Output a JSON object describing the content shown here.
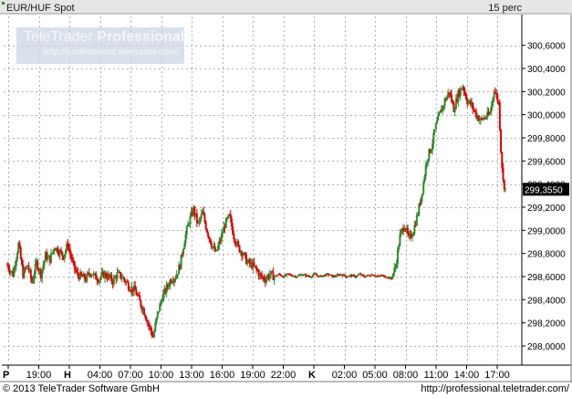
{
  "header": {
    "instrument": "EUR/HUF Spot",
    "interval": "15 perc"
  },
  "watermark": {
    "brand_regular": "TeleTrader",
    "brand_bold": "Professional",
    "url": "http://professional.teletrader.com/"
  },
  "footer": {
    "copyright": "© 2013 TeleTrader Software GmbH",
    "url": "http://professional.teletrader.com/"
  },
  "colors": {
    "up": "#2e8b2e",
    "down": "#e00000",
    "grid": "#b0b0b0",
    "header_bg": "#e6e6e6"
  },
  "chart_data": {
    "type": "candlestick",
    "ylim": [
      297.85,
      300.85
    ],
    "y_ticks": [
      "298,0000",
      "298,2000",
      "298,4000",
      "298,6000",
      "298,8000",
      "299,0000",
      "299,2000",
      "299,4000",
      "299,6000",
      "299,8000",
      "300,0000",
      "300,2000",
      "300,4000",
      "300,6000"
    ],
    "y_tick_values": [
      298.0,
      298.2,
      298.4,
      298.6,
      298.8,
      299.0,
      299.2,
      299.4,
      299.6,
      299.8,
      300.0,
      300.2,
      300.4,
      300.6
    ],
    "x_ticks": [
      {
        "label": "P",
        "bold": true
      },
      {
        "label": "19:00"
      },
      {
        "label": "H",
        "bold": true
      },
      {
        "label": "04:00"
      },
      {
        "label": "07:00"
      },
      {
        "label": "10:00"
      },
      {
        "label": "13:00"
      },
      {
        "label": "16:00"
      },
      {
        "label": "19:00"
      },
      {
        "label": "22:00"
      },
      {
        "label": "K",
        "bold": true
      },
      {
        "label": "02:00"
      },
      {
        "label": "05:00"
      },
      {
        "label": "08:00"
      },
      {
        "label": "11:00"
      },
      {
        "label": "14:00"
      },
      {
        "label": "17:00"
      }
    ],
    "last_price": "299,3550",
    "last_value": 299.355,
    "path": [
      [
        0,
        298.7
      ],
      [
        5,
        298.62
      ],
      [
        10,
        298.88
      ],
      [
        14,
        298.62
      ],
      [
        18,
        298.7
      ],
      [
        22,
        298.55
      ],
      [
        26,
        298.72
      ],
      [
        30,
        298.62
      ],
      [
        34,
        298.78
      ],
      [
        38,
        298.75
      ],
      [
        42,
        298.86
      ],
      [
        46,
        298.82
      ],
      [
        50,
        298.78
      ],
      [
        54,
        298.88
      ],
      [
        58,
        298.72
      ],
      [
        62,
        298.62
      ],
      [
        66,
        298.6
      ],
      [
        70,
        298.58
      ],
      [
        74,
        298.64
      ],
      [
        78,
        298.6
      ],
      [
        82,
        298.58
      ],
      [
        86,
        298.62
      ],
      [
        90,
        298.6
      ],
      [
        94,
        298.56
      ],
      [
        98,
        298.62
      ],
      [
        102,
        298.6
      ],
      [
        106,
        298.55
      ],
      [
        110,
        298.5
      ],
      [
        114,
        298.48
      ],
      [
        118,
        298.38
      ],
      [
        122,
        298.3
      ],
      [
        126,
        298.18
      ],
      [
        130,
        298.08
      ],
      [
        134,
        298.28
      ],
      [
        138,
        298.42
      ],
      [
        142,
        298.5
      ],
      [
        146,
        298.58
      ],
      [
        150,
        298.6
      ],
      [
        154,
        298.7
      ],
      [
        158,
        298.92
      ],
      [
        162,
        299.08
      ],
      [
        166,
        299.18
      ],
      [
        170,
        299.05
      ],
      [
        174,
        299.15
      ],
      [
        178,
        299.0
      ],
      [
        182,
        298.88
      ],
      [
        186,
        298.8
      ],
      [
        190,
        298.92
      ],
      [
        194,
        299.05
      ],
      [
        198,
        299.12
      ],
      [
        202,
        298.95
      ],
      [
        206,
        298.85
      ],
      [
        210,
        298.8
      ],
      [
        214,
        298.72
      ],
      [
        218,
        298.7
      ],
      [
        222,
        298.66
      ],
      [
        226,
        298.6
      ],
      [
        230,
        298.58
      ],
      [
        234,
        298.62
      ],
      [
        238,
        298.6
      ],
      [
        242,
        298.62
      ],
      [
        246,
        298.6
      ],
      [
        250,
        298.62
      ],
      [
        254,
        298.61
      ],
      [
        258,
        298.6
      ],
      [
        262,
        298.62
      ],
      [
        266,
        298.61
      ],
      [
        270,
        298.6
      ],
      [
        274,
        298.62
      ],
      [
        278,
        298.6
      ],
      [
        282,
        298.61
      ],
      [
        286,
        298.62
      ],
      [
        290,
        298.6
      ],
      [
        294,
        298.61
      ],
      [
        298,
        298.62
      ],
      [
        302,
        298.6
      ],
      [
        306,
        298.61
      ],
      [
        310,
        298.6
      ],
      [
        314,
        298.62
      ],
      [
        318,
        298.6
      ],
      [
        322,
        298.61
      ],
      [
        326,
        298.62
      ],
      [
        330,
        298.6
      ],
      [
        334,
        298.61
      ],
      [
        338,
        298.6
      ],
      [
        342,
        298.58
      ],
      [
        346,
        298.68
      ],
      [
        350,
        298.95
      ],
      [
        354,
        299.05
      ],
      [
        358,
        298.92
      ],
      [
        362,
        299.0
      ],
      [
        366,
        299.15
      ],
      [
        370,
        299.35
      ],
      [
        374,
        299.62
      ],
      [
        378,
        299.72
      ],
      [
        382,
        299.9
      ],
      [
        386,
        300.02
      ],
      [
        390,
        300.12
      ],
      [
        394,
        300.2
      ],
      [
        398,
        300.05
      ],
      [
        402,
        300.18
      ],
      [
        406,
        300.25
      ],
      [
        410,
        300.12
      ],
      [
        414,
        300.08
      ],
      [
        418,
        300.0
      ],
      [
        422,
        299.95
      ],
      [
        426,
        299.98
      ],
      [
        430,
        300.0
      ],
      [
        434,
        300.22
      ],
      [
        438,
        300.1
      ],
      [
        440,
        299.7
      ],
      [
        442,
        299.42
      ],
      [
        444,
        299.36
      ]
    ]
  }
}
